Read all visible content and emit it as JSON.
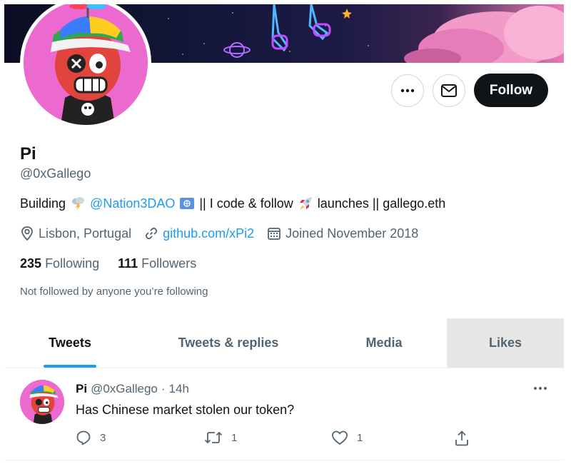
{
  "profile": {
    "name": "Pi",
    "handle": "@0xGallego",
    "bio": {
      "prefix": "Building",
      "mention": "@Nation3DAO",
      "middle": "|| I code & follow",
      "suffix": "launches || gallego.eth"
    },
    "location": "Lisbon, Portugal",
    "website": "github.com/xPi2",
    "joined": "Joined November 2018",
    "following_count": "235",
    "following_label": "Following",
    "followers_count": "111",
    "followers_label": "Followers",
    "not_followed_text": "Not followed by anyone you’re following"
  },
  "actions": {
    "follow_label": "Follow"
  },
  "tabs": [
    {
      "label": "Tweets",
      "active": true
    },
    {
      "label": "Tweets & replies",
      "active": false
    },
    {
      "label": "Media",
      "active": false
    },
    {
      "label": "Likes",
      "active": false
    }
  ],
  "tweet": {
    "author": "Pi",
    "handle": "@0xGallego",
    "separator": "·",
    "time": "14h",
    "text": "Has Chinese market stolen our token?",
    "replies": "3",
    "retweets": "1",
    "likes": "1"
  },
  "colors": {
    "accent": "#1d9bf0",
    "text": "#0f1419",
    "muted": "#536471",
    "avatar_bg": "#ec6ad0"
  },
  "icons": [
    "more-icon",
    "mail-icon",
    "location-icon",
    "link-icon",
    "calendar-icon",
    "reply-icon",
    "retweet-icon",
    "like-icon",
    "share-icon",
    "storm-emoji",
    "rocket-emoji",
    "un-flag-emoji"
  ]
}
